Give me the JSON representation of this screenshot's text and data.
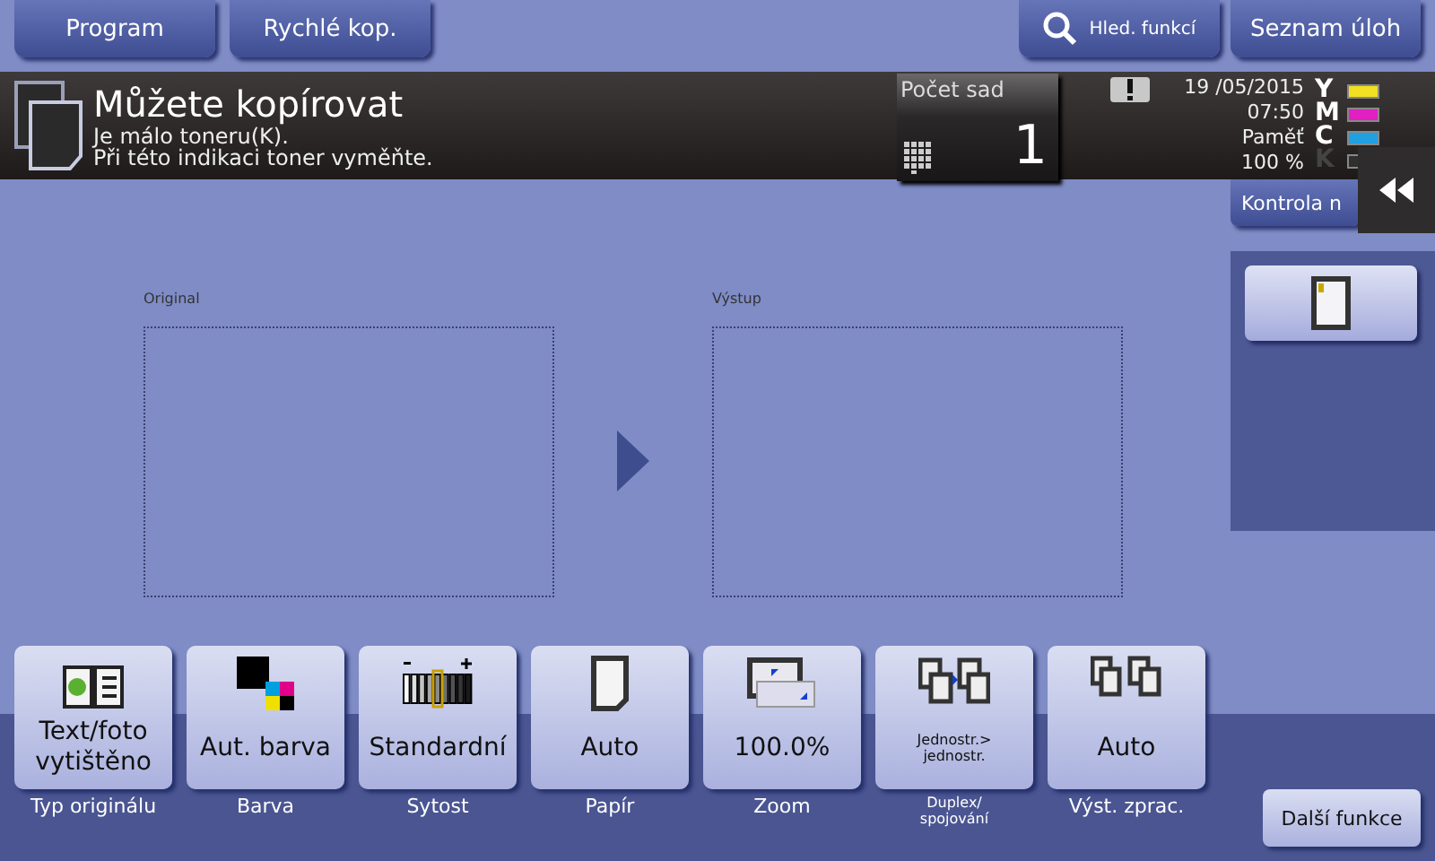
{
  "top_buttons": [
    {
      "label": "Program"
    },
    {
      "label": "Rychlé kop."
    }
  ],
  "search_button": {
    "label": "Hled. funkcí"
  },
  "job_list_button": {
    "label": "Seznam úloh"
  },
  "status": {
    "title": "Můžete kopírovat",
    "message": "Je málo toneru(K).\nPři této indikaci toner vyměňte."
  },
  "copies": {
    "label": "Počet sad",
    "value": "1"
  },
  "clock": {
    "date": "19 /05/2015",
    "time": "07:50",
    "memory_label": "Paměť",
    "memory_value": "100 %"
  },
  "toners": [
    {
      "letter": "Y",
      "color": "#f0e020"
    },
    {
      "letter": "M",
      "color": "#e020c0"
    },
    {
      "letter": "C",
      "color": "#20a0e0"
    },
    {
      "letter": "K",
      "color": "#303030"
    }
  ],
  "check_button": {
    "label": "Kontrola n"
  },
  "preview": {
    "original_label": "Original",
    "output_label": "Výstup"
  },
  "functions": [
    {
      "kind": "original",
      "value": "Text/foto vytištěno",
      "label": "Typ originálu"
    },
    {
      "kind": "color",
      "value": "Aut. barva",
      "label": "Barva"
    },
    {
      "kind": "density",
      "value": "Standardní",
      "label": "Sytost"
    },
    {
      "kind": "paper",
      "value": "Auto",
      "label": "Papír"
    },
    {
      "kind": "zoom",
      "value": "100.0%",
      "label": "Zoom"
    },
    {
      "kind": "duplex",
      "value": "Jednostr.> jednostr.",
      "label": "Duplex/ spojování"
    },
    {
      "kind": "finishing",
      "value": "Auto",
      "label": "Výst. zprac."
    }
  ],
  "more_button": {
    "label": "Další funkce"
  }
}
